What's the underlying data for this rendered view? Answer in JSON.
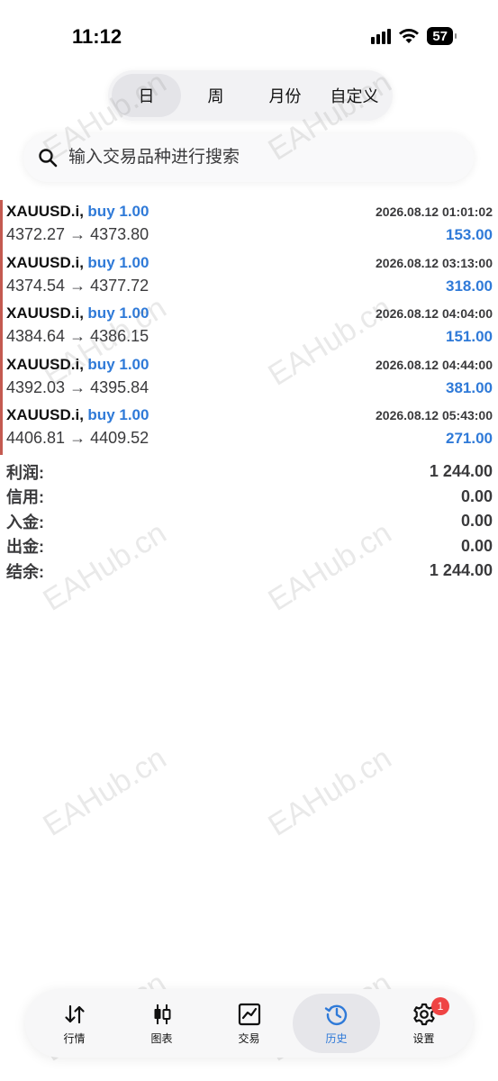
{
  "status_bar": {
    "time": "11:12",
    "battery": "57"
  },
  "period_tabs": [
    {
      "label": "日",
      "active": true
    },
    {
      "label": "周",
      "active": false
    },
    {
      "label": "月份",
      "active": false
    },
    {
      "label": "自定义",
      "active": false
    }
  ],
  "search": {
    "placeholder": "输入交易品种进行搜索"
  },
  "trades": [
    {
      "symbol": "XAUUSD.i,",
      "side": "buy 1.00",
      "time": "2026.08.12 01:01:02",
      "prices": "4372.27 → 4373.80",
      "profit": "153.00"
    },
    {
      "symbol": "XAUUSD.i,",
      "side": "buy 1.00",
      "time": "2026.08.12 03:13:00",
      "prices": "4374.54 → 4377.72",
      "profit": "318.00"
    },
    {
      "symbol": "XAUUSD.i,",
      "side": "buy 1.00",
      "time": "2026.08.12 04:04:00",
      "prices": "4384.64 → 4386.15",
      "profit": "151.00"
    },
    {
      "symbol": "XAUUSD.i,",
      "side": "buy 1.00",
      "time": "2026.08.12 04:44:00",
      "prices": "4392.03 → 4395.84",
      "profit": "381.00"
    },
    {
      "symbol": "XAUUSD.i,",
      "side": "buy 1.00",
      "time": "2026.08.12 05:43:00",
      "prices": "4406.81 → 4409.52",
      "profit": "271.00"
    }
  ],
  "summary": [
    {
      "label": "利润:",
      "value": "1 244.00"
    },
    {
      "label": "信用:",
      "value": "0.00"
    },
    {
      "label": "入金:",
      "value": "0.00"
    },
    {
      "label": "出金:",
      "value": "0.00"
    },
    {
      "label": "结余:",
      "value": "1 244.00"
    }
  ],
  "watermark": "EAHub.cn",
  "bottom_nav": [
    {
      "label": "行情",
      "icon": "quotes-arrows-icon",
      "active": false
    },
    {
      "label": "图表",
      "icon": "candlestick-chart-icon",
      "active": false
    },
    {
      "label": "交易",
      "icon": "trade-chart-icon",
      "active": false
    },
    {
      "label": "历史",
      "icon": "history-clock-icon",
      "active": true
    },
    {
      "label": "设置",
      "icon": "gear-icon",
      "active": false,
      "badge": "1"
    }
  ],
  "colors": {
    "accent": "#2f7ad8",
    "trade_bar": "#c45a50",
    "badge": "#ef4444"
  }
}
